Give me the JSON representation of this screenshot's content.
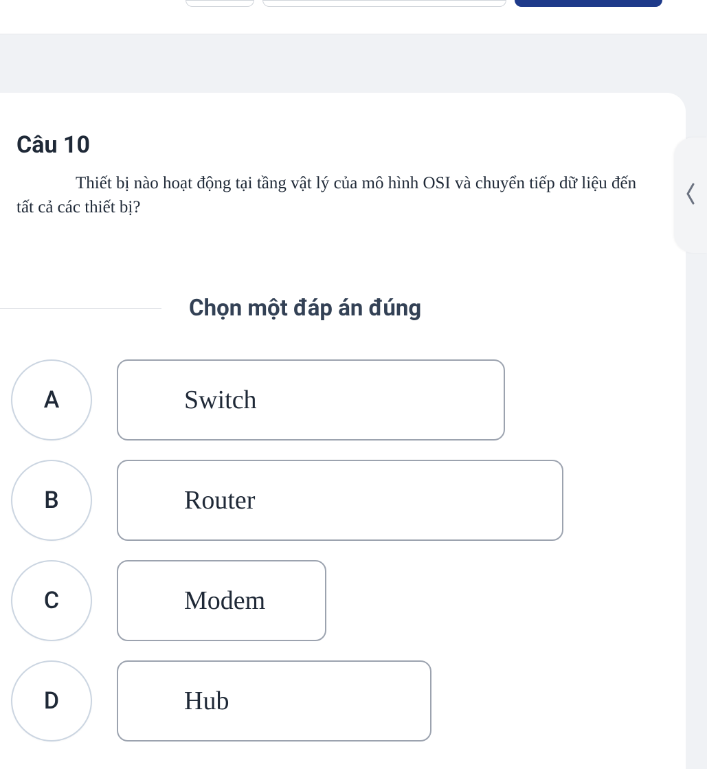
{
  "question": {
    "number_label": "Câu 10",
    "text": "Thiết bị nào hoạt động tại tầng vật lý của mô hình OSI và chuyển tiếp dữ liệu đến tất cả các thiết bị?"
  },
  "instruction": "Chọn một đáp án đúng",
  "answers": [
    {
      "letter": "A",
      "text": "Switch",
      "width_class": "w-a"
    },
    {
      "letter": "B",
      "text": "Router",
      "width_class": "w-b"
    },
    {
      "letter": "C",
      "text": "Modem",
      "width_class": "w-c"
    },
    {
      "letter": "D",
      "text": "Hub",
      "width_class": "w-d"
    }
  ]
}
